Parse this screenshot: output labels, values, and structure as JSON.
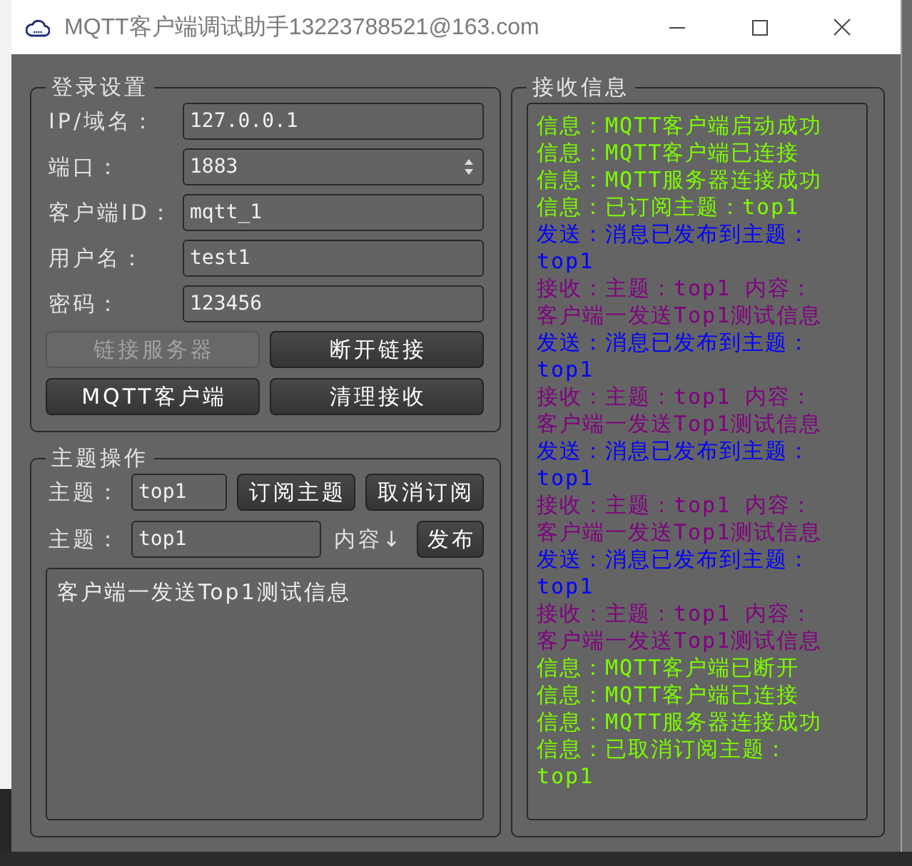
{
  "window": {
    "title": "MQTT客户端调试助手13223788521@163.com"
  },
  "login": {
    "title": "登录设置",
    "fields": [
      {
        "kind": "text",
        "label": "IP/域名：",
        "value": "127.0.0.1"
      },
      {
        "kind": "spin",
        "label": "端口：",
        "value": "1883"
      },
      {
        "kind": "text",
        "label": "客户端ID：",
        "value": "mqtt_1"
      },
      {
        "kind": "text",
        "label": "用户名：",
        "value": "test1"
      },
      {
        "kind": "text",
        "label": "密码：",
        "value": "123456"
      }
    ],
    "buttons": [
      {
        "label": "链接服务器",
        "disabled": true
      },
      {
        "label": "断开链接",
        "disabled": false
      },
      {
        "label": "MQTT客户端",
        "disabled": false
      },
      {
        "label": "清理接收",
        "disabled": false
      }
    ]
  },
  "topic": {
    "title": "主题操作",
    "subscribe": {
      "label": "主题：",
      "value": "top1",
      "buttons": [
        {
          "label": "订阅主题",
          "disabled": false
        },
        {
          "label": "取消订阅",
          "disabled": false
        }
      ]
    },
    "publish": {
      "label": "主题：",
      "value": "top1",
      "content_label": "内容↓",
      "button": {
        "label": "发布",
        "disabled": false
      }
    },
    "content": {
      "value": "客户端一发送Top1测试信息"
    }
  },
  "receive": {
    "title": "接收信息",
    "messages": [
      {
        "color": "#7cfc00",
        "lines": [
          "信息：MQTT客户端启动成功"
        ]
      },
      {
        "color": "#7cfc00",
        "lines": [
          "信息：MQTT客户端已连接"
        ]
      },
      {
        "color": "#7cfc00",
        "lines": [
          "信息：MQTT服务器连接成功"
        ]
      },
      {
        "color": "#7cfc00",
        "lines": [
          "信息：已订阅主题：top1"
        ]
      },
      {
        "color": "#0000ff",
        "lines": [
          "发送：消息已发布到主题：",
          "top1"
        ]
      },
      {
        "color": "#800080",
        "lines": [
          "接收：主题：top1 内容：",
          "客户端一发送Top1测试信息"
        ]
      },
      {
        "color": "#0000ff",
        "lines": [
          "发送：消息已发布到主题：",
          "top1"
        ]
      },
      {
        "color": "#800080",
        "lines": [
          "接收：主题：top1 内容：",
          "客户端一发送Top1测试信息"
        ]
      },
      {
        "color": "#0000ff",
        "lines": [
          "发送：消息已发布到主题：",
          "top1"
        ]
      },
      {
        "color": "#800080",
        "lines": [
          "接收：主题：top1 内容：",
          "客户端一发送Top1测试信息"
        ]
      },
      {
        "color": "#0000ff",
        "lines": [
          "发送：消息已发布到主题：",
          "top1"
        ]
      },
      {
        "color": "#800080",
        "lines": [
          "接收：主题：top1 内容：",
          "客户端一发送Top1测试信息"
        ]
      },
      {
        "color": "#7cfc00",
        "lines": [
          "信息：MQTT客户端已断开"
        ]
      },
      {
        "color": "#7cfc00",
        "lines": [
          "信息：MQTT客户端已连接"
        ]
      },
      {
        "color": "#7cfc00",
        "lines": [
          "信息：MQTT服务器连接成功"
        ]
      },
      {
        "color": "#7cfc00",
        "lines": [
          "信息：已取消订阅主题：",
          "top1"
        ]
      }
    ]
  }
}
